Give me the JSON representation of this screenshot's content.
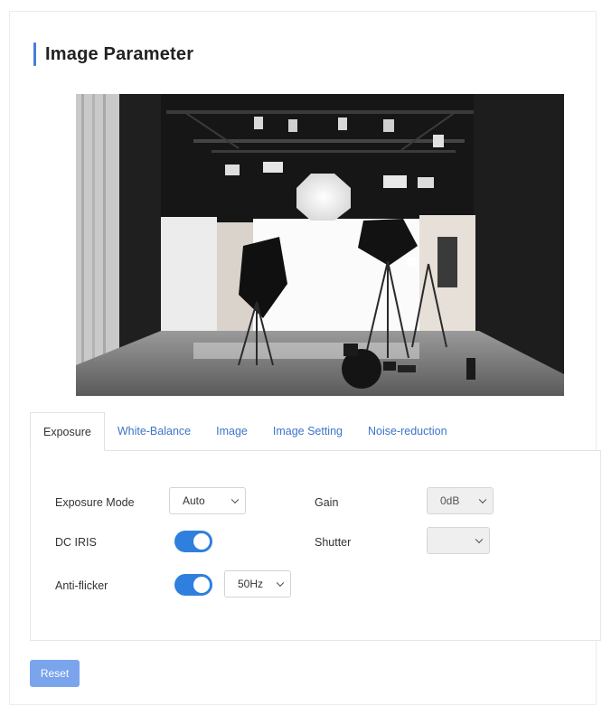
{
  "page": {
    "title": "Image Parameter"
  },
  "tabs": [
    {
      "label": "Exposure",
      "active": true
    },
    {
      "label": "White-Balance",
      "active": false
    },
    {
      "label": "Image",
      "active": false
    },
    {
      "label": "Image Setting",
      "active": false
    },
    {
      "label": "Noise-reduction",
      "active": false
    }
  ],
  "exposure": {
    "exposure_mode": {
      "label": "Exposure Mode",
      "value": "Auto"
    },
    "gain": {
      "label": "Gain",
      "value": "0dB"
    },
    "dc_iris": {
      "label": "DC IRIS",
      "on": true
    },
    "shutter": {
      "label": "Shutter",
      "value": ""
    },
    "anti_flicker": {
      "label": "Anti-flicker",
      "on": true,
      "frequency": "50Hz"
    }
  },
  "actions": {
    "reset_label": "Reset"
  },
  "colors": {
    "accent": "#2f7fde",
    "title_bar": "#4a7bd8",
    "tab_link": "#3d74c9",
    "reset_button": "#7aa4ec"
  }
}
